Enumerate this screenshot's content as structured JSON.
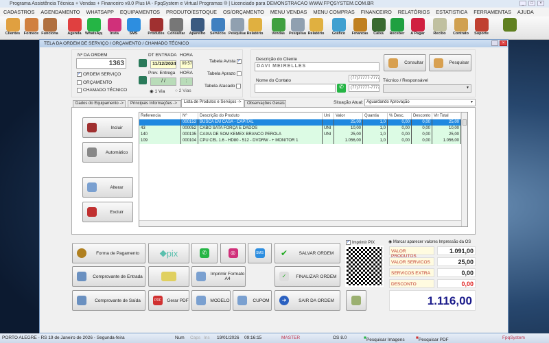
{
  "app": {
    "title": "Programa Assistência Técnica + Vendas + Financeiro v8.0 Plus IA - FpqSystem e Virtual Programas ® | Licenciado para  DEMONSTRACAO WWW.FPQSYSTEM.COM.BR"
  },
  "menu": [
    "CADASTROS",
    "AGENDAMENTO",
    "WHATSAPP",
    "EQUIPAMENTOS",
    "PRODUTO/ESTOQUE",
    "OS/ORÇAMENTO",
    "MENU VENDAS",
    "MENU COMPRAS",
    "FINANCEIRO",
    "RELATÓRIOS",
    "ESTATISTICA",
    "FERRAMENTAS",
    "AJUDA"
  ],
  "toolbar": [
    {
      "label": "Clientes",
      "icon": "clients-icon",
      "color": "#e0a040"
    },
    {
      "label": "Fornece",
      "icon": "supplier-icon",
      "color": "#d08040"
    },
    {
      "label": "Funciona",
      "icon": "employee-icon",
      "color": "#b07040"
    },
    {
      "label": "Agenda",
      "icon": "calendar-icon",
      "color": "#e04040"
    },
    {
      "label": "WhatsApp",
      "icon": "whatsapp-icon",
      "color": "#25b545"
    },
    {
      "label": "Insta",
      "icon": "instagram-icon",
      "color": "#d0307a"
    },
    {
      "label": "SMS",
      "icon": "sms-icon",
      "color": "#2d8ee0"
    },
    {
      "label": "Produtos",
      "icon": "products-icon",
      "color": "#a03030"
    },
    {
      "label": "Consultar",
      "icon": "barcode-icon",
      "color": "#777777"
    },
    {
      "label": "Aparelho",
      "icon": "device-icon",
      "color": "#3a5a80"
    },
    {
      "label": "Servicos",
      "icon": "services-icon",
      "color": "#4080c0"
    },
    {
      "label": "Pesquisar",
      "icon": "search-doc-icon",
      "color": "#90a0b0"
    },
    {
      "label": "Relatório",
      "icon": "report-icon",
      "color": "#e0b040"
    },
    {
      "label": "Vendas",
      "icon": "cart-icon",
      "color": "#40a040"
    },
    {
      "label": "Pesquisar",
      "icon": "search-doc-icon",
      "color": "#90a0b0"
    },
    {
      "label": "Relatório",
      "icon": "report-icon",
      "color": "#e0b040"
    },
    {
      "label": "Gráfico",
      "icon": "chart-icon",
      "color": "#40a0d0"
    },
    {
      "label": "Financas",
      "icon": "finance-icon",
      "color": "#c08020"
    },
    {
      "label": "Caixa",
      "icon": "cashbook-icon",
      "color": "#3a6a30"
    },
    {
      "label": "Receber",
      "icon": "receive-icon",
      "color": "#20a040"
    },
    {
      "label": "A Pagar",
      "icon": "pay-icon",
      "color": "#d02040"
    },
    {
      "label": "Recibo",
      "icon": "receipt-icon",
      "color": "#c0c0a0"
    },
    {
      "label": "Contrato",
      "icon": "contract-icon",
      "color": "#d0a050"
    },
    {
      "label": "Suporte",
      "icon": "support-icon",
      "color": "#c04030"
    },
    {
      "label": "",
      "icon": "exit-icon",
      "color": "#608020"
    }
  ],
  "dialog": {
    "title": "TELA DA ORDEM DE SERVIÇO / ORÇAMENTO / CHAMADO TÉCNICO"
  },
  "order": {
    "number_label": "Nº DA ORDEM",
    "number": "1363",
    "types": [
      {
        "label": "ORDEM SERVIÇO",
        "checked": true
      },
      {
        "label": "ORÇAMENTO",
        "checked": false
      },
      {
        "label": "CHAMADO TÉCNICO",
        "checked": false
      }
    ],
    "entry_date_label": "DT ENTRADA",
    "entry_time_label": "HORA",
    "entry_date": "11/12/2024",
    "entry_time": "09:57",
    "delivery_label": "Prev. Entrega",
    "delivery_time_label": "HORA",
    "delivery_date": " / /",
    "delivery_time": ":",
    "copies": [
      {
        "label": "1 Via",
        "selected": true
      },
      {
        "label": "2 Vias",
        "selected": false
      }
    ],
    "tables": [
      {
        "label": "Tabela Avista",
        "checked": true
      },
      {
        "label": "Tabela Aprazo",
        "checked": false
      },
      {
        "label": "Tabela Atacado",
        "checked": false
      }
    ]
  },
  "client": {
    "desc_label": "Descrição do Cliente",
    "name": "DAVI MEIRELLES",
    "contact_label": "Nome do Contato",
    "contact": "",
    "phone1": "(77)77777-7777",
    "phone2": "(77)77777-7777",
    "tech_label": "Técnico / Responsável",
    "tech": "",
    "consult": "Consultar",
    "search": "Pesquisar"
  },
  "tabs": [
    "Dados do Equipamento ->",
    "Principais Informações ->",
    "Lista de Produtos e Serviços ->",
    "Observações Gerais"
  ],
  "status": {
    "label": "Situação Atual:",
    "value": "Aguardando Aprovação"
  },
  "side_buttons": [
    "Incluir",
    "Automático",
    "Alterar",
    "Excluir"
  ],
  "table": {
    "columns": [
      "Referencia",
      "Nº",
      "Descrição do Produto",
      "Uni",
      "Valor",
      "Quantia",
      "% Desc.",
      "Desconto",
      "Vlr Total"
    ],
    "rows": [
      [
        "",
        "000153",
        "BUSCA EM CASA - CAPITAL",
        "",
        "25,00",
        "1,0",
        "0,00",
        "0,00",
        "25,00"
      ],
      [
        "43",
        "000052",
        "CABO  SATA FORÇA  E  DADOS",
        "UNI",
        "10,00",
        "1,0",
        "0,00",
        "0,00",
        "10,00"
      ],
      [
        "140",
        "000135",
        "CAIXA DE SOM KEMEX BRANCO PÉROLA",
        "UNI",
        "25,00",
        "1,0",
        "0,00",
        "0,00",
        "25,00"
      ],
      [
        "109",
        "000104",
        "CPU CEL 1.6 - HD80 - 512 - DVDRW -   + MONITOR  1",
        "",
        "1.056,00",
        "1,0",
        "0,00",
        "0,00",
        "1.056,00"
      ]
    ]
  },
  "actions": {
    "payment": "Forma de Pagamento",
    "save": "SALVAR ORDEM",
    "entry_receipt": "Comprovante de Entrada",
    "print_a4": "Imprimir Formato A4",
    "finish": "FINALIZAR ORDEM",
    "exit_receipt": "Comprovante de Saída",
    "pdf": "Gerar PDF",
    "model": "MODELO",
    "coupon": "CUPOM",
    "leave": "SAIR DA ORDEM",
    "pix": "pix",
    "print_pix": "Imprimir PIX"
  },
  "totals": {
    "mark_label": "Marcar aparecer valores Impressão da OS",
    "items": [
      {
        "label": "VALOR PRODUTOS",
        "value": "1.091,00"
      },
      {
        "label": "VALOR SERVICOS",
        "value": "25,00"
      },
      {
        "label": "SERVICOS EXTRA",
        "value": "0,00"
      },
      {
        "label": "DESCONTO",
        "value": "0,00"
      }
    ],
    "total": "1.116,00"
  },
  "statusbar": {
    "location": "PORTO ALEGRE - RS 19 de Janeiro de 2026 - Segunda-feira",
    "num": "Num",
    "caps": "Caps",
    "ins": "Ins",
    "date": "19/01/2026",
    "time": "09:16:15",
    "user": "MASTER",
    "os": "OS 8.0",
    "img": "Pesquisar Imagens",
    "pdf": "Pesquisar PDF",
    "brand": "FpqSystem"
  }
}
